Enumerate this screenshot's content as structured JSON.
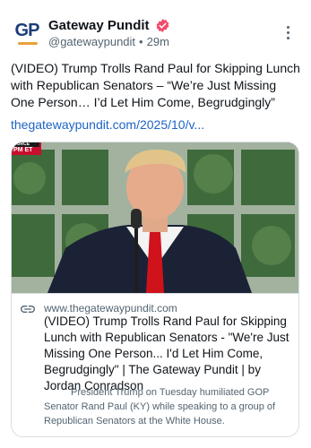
{
  "author": {
    "display_name": "Gateway Pundit",
    "handle": "@gatewaypundit",
    "separator": "•",
    "time_ago": "29m",
    "avatar_text": "GP"
  },
  "post": {
    "text": "(VIDEO) Trump Trolls Rand Paul for Skipping Lunch with Republican Senators – “We’re Just Missing One Person… I’d Let Him Come, Begrudgingly”",
    "link": "thegatewaypundit.com/2025/10/v..."
  },
  "card": {
    "badge_top": "OURCE",
    "badge_bottom": "PM ET",
    "domain": "www.thegatewaypundit.com",
    "title": "(VIDEO) Trump Trolls Rand Paul for Skipping Lunch with Republican Senators - \"We're Just Missing One Person... I'd Let Him Come, Begrudgingly\" | The Gateway Pundit | by Jordan Conradson",
    "description": "President Trump on Tuesday humiliated GOP Senator Rand Paul (KY) while speaking to a group of Republican Senators at the White House."
  },
  "colors": {
    "link": "#1d64c6",
    "verified": "#f24b6a",
    "brand_navy": "#1c3d7a",
    "brand_gold": "#e8a23a"
  },
  "icons": [
    "verified-badge-icon",
    "more-options-icon",
    "link-icon"
  ]
}
